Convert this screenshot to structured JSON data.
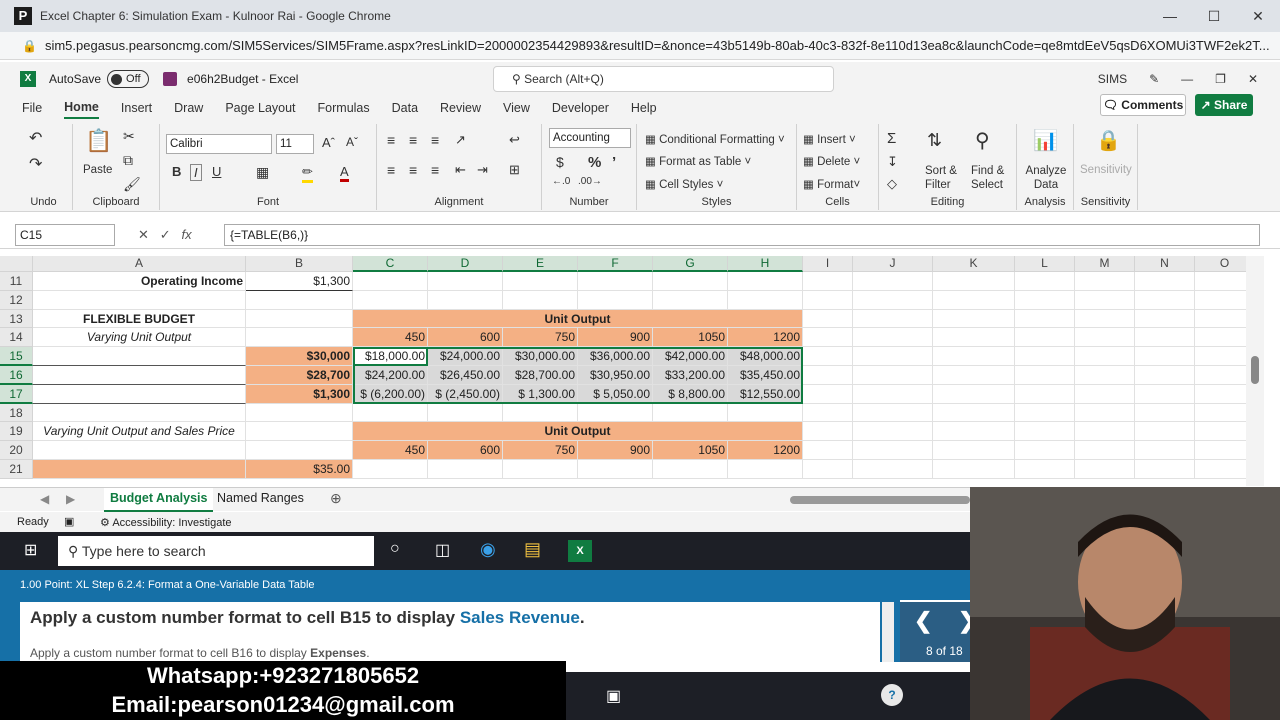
{
  "chrome": {
    "title": "Excel Chapter 6: Simulation Exam - Kulnoor Rai - Google Chrome",
    "url": "sim5.pegasus.pearsoncmg.com/SIM5Services/SIM5Frame.aspx?resLinkID=2000002354429893&resultID=&nonce=43b5149b-80ab-40c3-832f-8e110d13ea8c&launchCode=qe8mtdEeV5qsD6XOMUi3TWF2ek2T..."
  },
  "excel": {
    "autosave_label": "AutoSave",
    "autosave_state": "Off",
    "filename": "e06h2Budget - Excel",
    "search_placeholder": "Search (Alt+Q)",
    "user": "SIMS"
  },
  "menu": {
    "items": [
      "File",
      "Home",
      "Insert",
      "Draw",
      "Page Layout",
      "Formulas",
      "Data",
      "Review",
      "View",
      "Developer",
      "Help"
    ],
    "comments": "Comments",
    "share": "Share"
  },
  "ribbon": {
    "groups": {
      "undo": "Undo",
      "clipboard": "Clipboard",
      "font": "Font",
      "alignment": "Alignment",
      "number": "Number",
      "styles": "Styles",
      "cells": "Cells",
      "editing": "Editing",
      "analysis": "Analysis",
      "sensitivity": "Sensitivity"
    },
    "paste": "Paste",
    "font_name": "Calibri",
    "font_size": "11",
    "number_format": "Accounting",
    "conditional_formatting": "Conditional Formatting",
    "format_as_table": "Format as Table",
    "cell_styles": "Cell Styles",
    "insert": "Insert",
    "delete": "Delete",
    "format": "Format",
    "sort_filter": "Sort & Filter",
    "find_select": "Find & Select",
    "analyze_data": "Analyze Data",
    "sensitivity_btn": "Sensitivity"
  },
  "formula_bar": {
    "name_box": "C15",
    "formula": "{=TABLE(B6,)}"
  },
  "grid": {
    "columns": [
      "A",
      "B",
      "C",
      "D",
      "E",
      "F",
      "G",
      "H",
      "I",
      "J",
      "K",
      "L",
      "M",
      "N",
      "O"
    ],
    "rows": [
      "11",
      "12",
      "13",
      "14",
      "15",
      "16",
      "17",
      "18",
      "19",
      "20",
      "21"
    ],
    "a11": "Operating Income",
    "b11": "$1,300",
    "a13": "FLEXIBLE BUDGET",
    "unit_output": "Unit Output",
    "a14": "Varying Unit Output",
    "outputs": [
      "450",
      "600",
      "750",
      "900",
      "1050",
      "1200"
    ],
    "b15": "$30,000",
    "row15": [
      "$18,000.00",
      "$24,000.00",
      "$30,000.00",
      "$36,000.00",
      "$42,000.00",
      "$48,000.00"
    ],
    "b16": "$28,700",
    "row16": [
      "$24,200.00",
      "$26,450.00",
      "$28,700.00",
      "$30,950.00",
      "$33,200.00",
      "$35,450.00"
    ],
    "b17": "$1,300",
    "row17": [
      "$ (6,200.00)",
      "$ (2,450.00)",
      "$  1,300.00",
      "$  5,050.00",
      "$  8,800.00",
      "$12,550.00"
    ],
    "a19": "Varying Unit Output and Sales Price",
    "unit_output2": "Unit Output",
    "outputs2": [
      "450",
      "600",
      "750",
      "900",
      "1050",
      "1200"
    ],
    "b21": "$35.00"
  },
  "sheets": {
    "active": "Budget Analysis",
    "other": "Named Ranges"
  },
  "status": {
    "ready": "Ready",
    "accessibility": "Accessibility: Investigate"
  },
  "taskbar": {
    "search_placeholder": "Type here to search"
  },
  "sim": {
    "step": "1.00 Point: XL Step 6.2.4: Format a One-Variable Data Table",
    "instruction_prefix": "Apply a custom number format to cell B15 to display ",
    "instruction_highlight": "Sales Revenue",
    "instruction_suffix": ".",
    "next_prefix": "Apply a custom number format to cell B16 to display ",
    "next_highlight": "Expenses",
    "next_suffix": ".",
    "progress": "8 of 18"
  },
  "overlay": {
    "whatsapp": "Whatsapp:+923271805652",
    "email": "Email:pearson01234@gmail.com"
  }
}
